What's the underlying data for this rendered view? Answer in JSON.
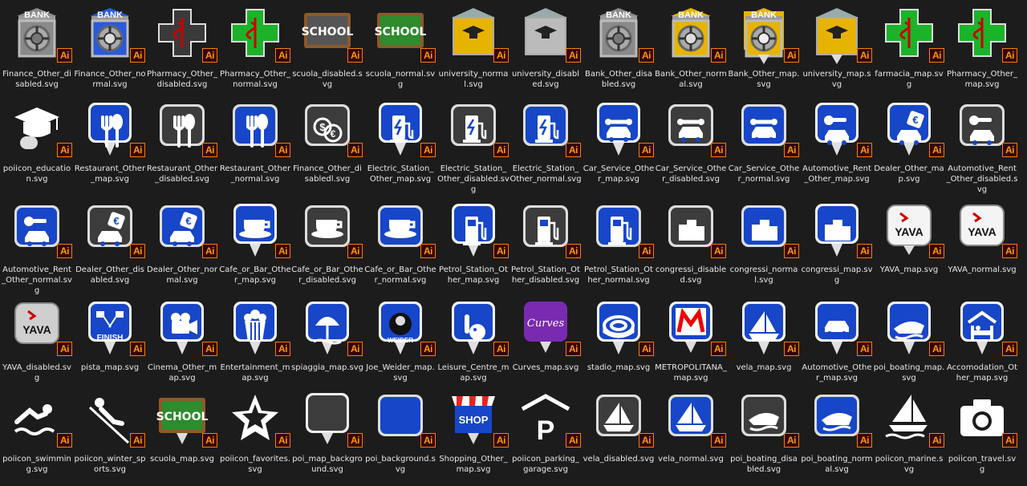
{
  "badge": "Ai",
  "colors": {
    "background": "#1c1c1c",
    "tile_blue": "#1746c8",
    "tile_gray": "#3c3c3c",
    "tile_white": "#f2f2f2",
    "cross_green": "#1bb32a",
    "board_green": "#2e8b2e",
    "gold": "#e6b400",
    "ai_orange": "#ff7c00",
    "ai_bg": "#330000",
    "label": "#e8e8e8"
  },
  "files": [
    {
      "name": "Finance_Other_disabled.svg",
      "icon": "bank-vault-gray-icon"
    },
    {
      "name": "Finance_Other_normal.svg",
      "icon": "bank-vault-blue-icon"
    },
    {
      "name": "Pharmacy_Other_disabled.svg",
      "icon": "pharmacy-cross-gray-icon"
    },
    {
      "name": "Pharmacy_Other_normal.svg",
      "icon": "pharmacy-cross-green-icon"
    },
    {
      "name": "scuola_disabled.svg",
      "icon": "school-board-gray-icon",
      "text": "SCHOOL"
    },
    {
      "name": "scuola_normal.svg",
      "icon": "school-board-green-icon",
      "text": "SCHOOL"
    },
    {
      "name": "university_normal.svg",
      "icon": "university-building-icon"
    },
    {
      "name": "university_disabled.svg",
      "icon": "university-building-gray-icon"
    },
    {
      "name": "Bank_Other_disabled.svg",
      "icon": "bank-vault-gray-icon"
    },
    {
      "name": "Bank_Other_normal.svg",
      "icon": "bank-vault-gold-icon"
    },
    {
      "name": "Bank_Other_map.svg",
      "icon": "bank-map-pin-icon"
    },
    {
      "name": "university_map.svg",
      "icon": "university-map-pin-icon"
    },
    {
      "name": "farmacia_map.svg",
      "icon": "pharmacy-cross-map-icon"
    },
    {
      "name": "Pharmacy_Other_map.svg",
      "icon": "pharmacy-cross-map-icon"
    },
    {
      "name": "poiicon_education.svg",
      "icon": "graduation-cap-icon"
    },
    {
      "name": "Restaurant_Other_map.svg",
      "icon": "fork-spoon-map-icon"
    },
    {
      "name": "Restaurant_Other_disabled.svg",
      "icon": "fork-spoon-gray-icon"
    },
    {
      "name": "Restaurant_Other_normal.svg",
      "icon": "fork-spoon-blue-icon"
    },
    {
      "name": "Finance_Other_disabledl.svg",
      "icon": "coins-gray-icon"
    },
    {
      "name": "Electric_Station_Other_map.svg",
      "icon": "ev-charger-map-icon"
    },
    {
      "name": "Electric_Station_Other_disabled.svg",
      "icon": "ev-charger-gray-icon"
    },
    {
      "name": "Electric_Station_Other_normal.svg",
      "icon": "ev-charger-blue-icon"
    },
    {
      "name": "Car_Service_Other_map.svg",
      "icon": "car-wrench-map-icon"
    },
    {
      "name": "Car_Service_Other_disabled.svg",
      "icon": "car-wrench-gray-icon"
    },
    {
      "name": "Car_Service_Other_normal.svg",
      "icon": "car-wrench-blue-icon"
    },
    {
      "name": "Automotive_Rent_Other_map.svg",
      "icon": "car-key-map-icon"
    },
    {
      "name": "Dealer_Other_map.svg",
      "icon": "car-euro-map-icon"
    },
    {
      "name": "Automotive_Rent_Other_disabled.svg",
      "icon": "car-key-gray-icon"
    },
    {
      "name": "Automotive_Rent_Other_normal.svg",
      "icon": "car-key-blue-icon"
    },
    {
      "name": "Dealer_Other_disabled.svg",
      "icon": "car-euro-gray-icon"
    },
    {
      "name": "Dealer_Other_normal.svg",
      "icon": "car-euro-blue-icon"
    },
    {
      "name": "Cafe_or_Bar_Other_map.svg",
      "icon": "coffee-cup-map-icon"
    },
    {
      "name": "Cafe_or_Bar_Other_disabled.svg",
      "icon": "coffee-cup-gray-icon"
    },
    {
      "name": "Cafe_or_Bar_Other_normal.svg",
      "icon": "coffee-cup-blue-icon"
    },
    {
      "name": "Petrol_Station_Other_map.svg",
      "icon": "fuel-pump-map-icon"
    },
    {
      "name": "Petrol_Station_Other_disabled.svg",
      "icon": "fuel-pump-gray-icon"
    },
    {
      "name": "Petrol_Station_Other_normal.svg",
      "icon": "fuel-pump-blue-icon"
    },
    {
      "name": "congressi_disabled.svg",
      "icon": "buildings-gray-icon"
    },
    {
      "name": "congressi_normal.svg",
      "icon": "buildings-blue-icon"
    },
    {
      "name": "congressi_map.svg",
      "icon": "buildings-map-icon"
    },
    {
      "name": "YAVA_map.svg",
      "icon": "yava-logo-map-icon",
      "text": "YAVA"
    },
    {
      "name": "YAVA_normal.svg",
      "icon": "yava-logo-white-icon",
      "text": "YAVA"
    },
    {
      "name": "YAVA_disabled.svg",
      "icon": "yava-logo-gray-icon",
      "text": "YAVA"
    },
    {
      "name": "pista_map.svg",
      "icon": "finish-flags-map-icon",
      "text": "FINISH"
    },
    {
      "name": "Cinema_Other_map.svg",
      "icon": "film-projector-map-icon"
    },
    {
      "name": "Entertainment_map.svg",
      "icon": "popcorn-map-icon"
    },
    {
      "name": "spiaggia_map.svg",
      "icon": "beach-umbrella-map-icon"
    },
    {
      "name": "Joe_Weider_map.svg",
      "icon": "weider-logo-map-icon",
      "text": "WEIDER"
    },
    {
      "name": "Leisure_Centre_map.svg",
      "icon": "bowling-map-icon"
    },
    {
      "name": "Curves_map.svg",
      "icon": "curves-logo-icon",
      "text": "Curves"
    },
    {
      "name": "stadio_map.svg",
      "icon": "stadium-map-icon"
    },
    {
      "name": "METROPOLITANA_map.svg",
      "icon": "metro-m-logo-icon"
    },
    {
      "name": "vela_map.svg",
      "icon": "sailboat-map-icon"
    },
    {
      "name": "Automotive_Other_map.svg",
      "icon": "car-front-map-icon"
    },
    {
      "name": "poi_boating_map.svg",
      "icon": "speedboat-map-icon"
    },
    {
      "name": "Accomodation_Other_map.svg",
      "icon": "bed-house-map-icon"
    },
    {
      "name": "poiicon_swimming.svg",
      "icon": "swimmer-icon"
    },
    {
      "name": "poiicon_winter_sports.svg",
      "icon": "skier-icon"
    },
    {
      "name": "scuola_map.svg",
      "icon": "school-board-map-icon",
      "text": "SCHOOL"
    },
    {
      "name": "poiicon_favorites.svg",
      "icon": "star-icon"
    },
    {
      "name": "poi_map_background.svg",
      "icon": "map-pin-background-icon"
    },
    {
      "name": "poi_background.svg",
      "icon": "blue-square-background-icon"
    },
    {
      "name": "Shopping_Other_map.svg",
      "icon": "shop-awning-map-icon",
      "text": "SHOP"
    },
    {
      "name": "poiicon_parking_garage.svg",
      "icon": "parking-garage-icon"
    },
    {
      "name": "vela_disabled.svg",
      "icon": "sailboat-gray-icon"
    },
    {
      "name": "vela_normal.svg",
      "icon": "sailboat-blue-icon"
    },
    {
      "name": "poi_boating_disabled.svg",
      "icon": "speedboat-gray-icon"
    },
    {
      "name": "poi_boating_normal.svg",
      "icon": "speedboat-blue-icon"
    },
    {
      "name": "poiicon_marine.svg",
      "icon": "sailboat-waves-icon"
    },
    {
      "name": "poiicon_travel.svg",
      "icon": "camera-icon"
    }
  ]
}
